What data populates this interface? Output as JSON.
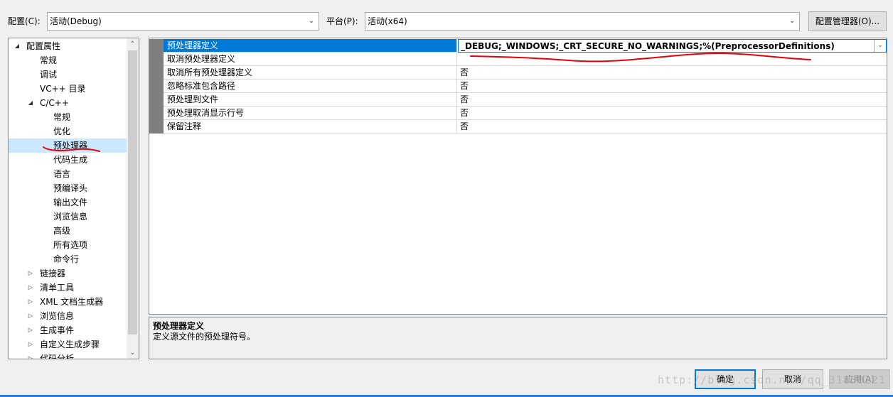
{
  "topbar": {
    "config_label": "配置(C):",
    "config_value": "活动(Debug)",
    "platform_label": "平台(P):",
    "platform_value": "活动(x64)",
    "config_manager_label": "配置管理器(O)..."
  },
  "tree": {
    "root": "配置属性",
    "items": [
      "常规",
      "调试",
      "VC++ 目录",
      "C/C++",
      "常规",
      "优化",
      "预处理器",
      "代码生成",
      "语言",
      "预编译头",
      "输出文件",
      "浏览信息",
      "高级",
      "所有选项",
      "命令行",
      "链接器",
      "清单工具",
      "XML 文档生成器",
      "浏览信息",
      "生成事件",
      "自定义生成步骤",
      "代码分析"
    ],
    "selected": "预处理器"
  },
  "grid": {
    "rows": [
      {
        "name": "预处理器定义",
        "value": "_DEBUG;_WINDOWS;_CRT_SECURE_NO_WARNINGS;%(PreprocessorDefinitions)"
      },
      {
        "name": "取消预处理器定义",
        "value": ""
      },
      {
        "name": "取消所有预处理器定义",
        "value": "否"
      },
      {
        "name": "忽略标准包含路径",
        "value": "否"
      },
      {
        "name": "预处理到文件",
        "value": "否"
      },
      {
        "name": "预处理取消显示行号",
        "value": "否"
      },
      {
        "name": "保留注释",
        "value": "否"
      }
    ]
  },
  "description": {
    "title": "预处理器定义",
    "text": "定义源文件的预处理符号。"
  },
  "buttons": {
    "ok": "确定",
    "cancel": "取消",
    "apply": "应用(A)"
  },
  "watermark": "http://blog.csdn.net/qq_31838221",
  "icons": {
    "expanded": "triangle-down-icon",
    "collapsed": "triangle-right-icon",
    "dropdown": "chevron-down-icon"
  },
  "colors": {
    "selection_blue": "#0078d7",
    "tree_selection": "#cce8ff",
    "annotation_red": "#e8000b"
  }
}
